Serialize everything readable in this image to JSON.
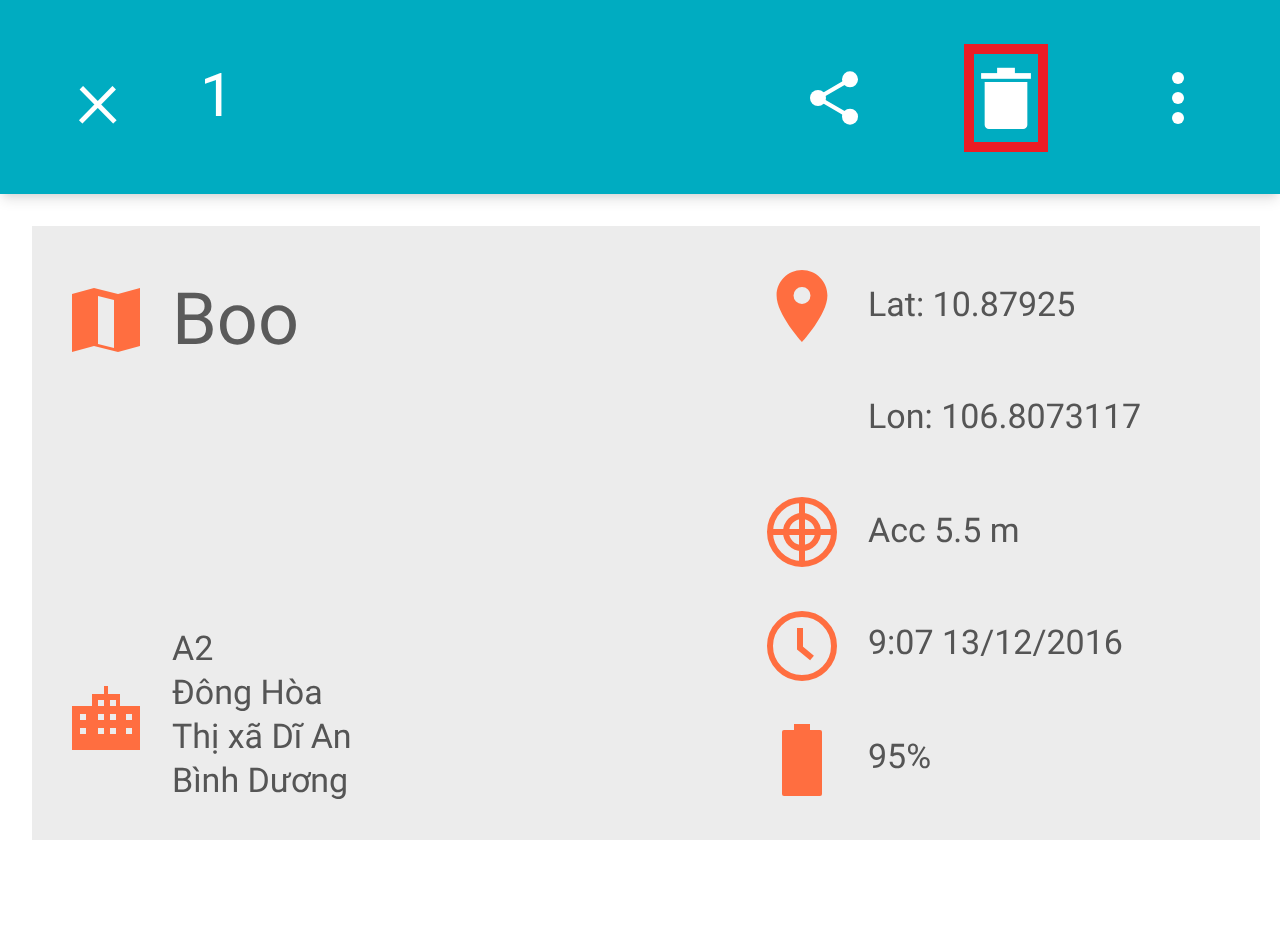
{
  "toolbar": {
    "close": "×",
    "count": "1",
    "actions": [
      {
        "kind": "share",
        "highlighted": false
      },
      {
        "kind": "delete",
        "highlighted": true
      },
      {
        "kind": "more",
        "highlighted": false
      }
    ]
  },
  "card": {
    "title": "Boo",
    "address": [
      "A2",
      "Đông Hòa",
      "Thị xã Dĩ An",
      "Bình Dương"
    ],
    "details": [
      {
        "kind": "location",
        "text": "Lat: 10.87925"
      },
      {
        "kind": "none",
        "text": "Lon: 106.8073117"
      },
      {
        "kind": "accuracy",
        "text": "Acc 5.5 m"
      },
      {
        "kind": "time",
        "text": "9:07 13/12/2016"
      },
      {
        "kind": "battery",
        "text": "95%"
      }
    ]
  }
}
